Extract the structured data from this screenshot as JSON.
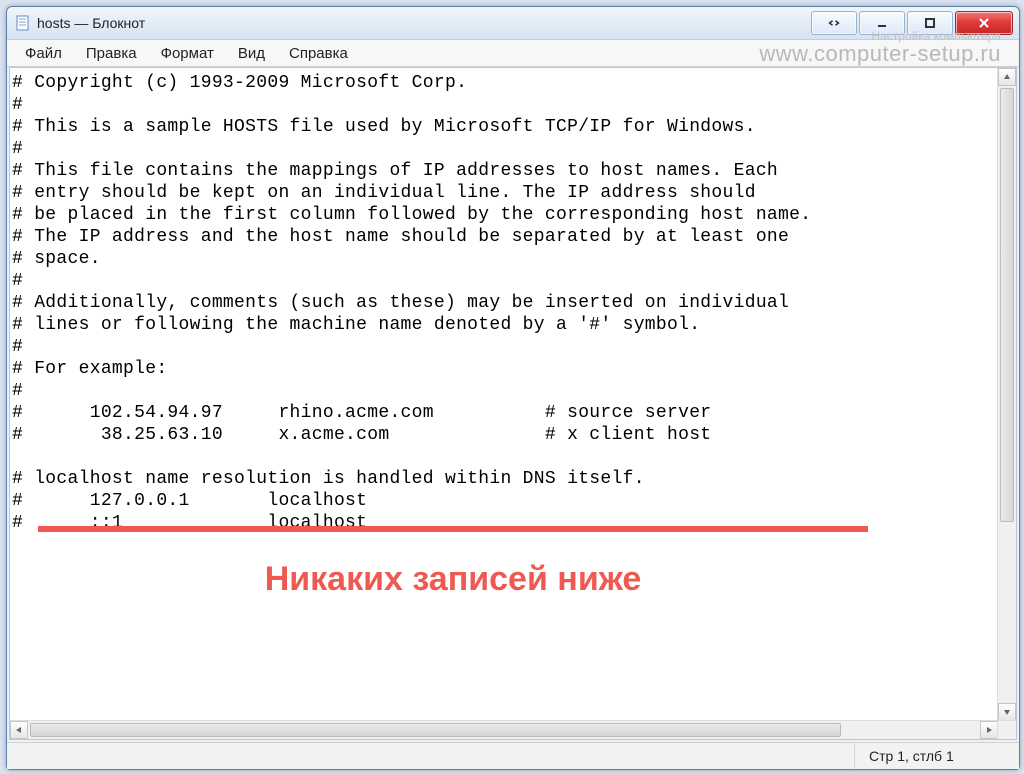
{
  "window": {
    "title": "hosts — Блокнот"
  },
  "menu": {
    "items": [
      "Файл",
      "Правка",
      "Формат",
      "Вид",
      "Справка"
    ]
  },
  "watermark": {
    "top": "Настройка компьютера",
    "url": "www.computer-setup.ru"
  },
  "hosts_file": {
    "lines": [
      "# Copyright (c) 1993-2009 Microsoft Corp.",
      "#",
      "# This is a sample HOSTS file used by Microsoft TCP/IP for Windows.",
      "#",
      "# This file contains the mappings of IP addresses to host names. Each",
      "# entry should be kept on an individual line. The IP address should",
      "# be placed in the first column followed by the corresponding host name.",
      "# The IP address and the host name should be separated by at least one",
      "# space.",
      "#",
      "# Additionally, comments (such as these) may be inserted on individual",
      "# lines or following the machine name denoted by a '#' symbol.",
      "#",
      "# For example:",
      "#",
      "#      102.54.94.97     rhino.acme.com          # source server",
      "#       38.25.63.10     x.acme.com              # x client host",
      "",
      "# localhost name resolution is handled within DNS itself.",
      "#      127.0.0.1       localhost",
      "#      ::1             localhost"
    ]
  },
  "annotation": {
    "text": "Никаких записей ниже",
    "color": "#ee5a52"
  },
  "status": {
    "position": "Стр 1, стлб 1"
  },
  "controls": {
    "nav": "nav",
    "minimize": "minimize",
    "maximize": "maximize",
    "close": "close"
  }
}
